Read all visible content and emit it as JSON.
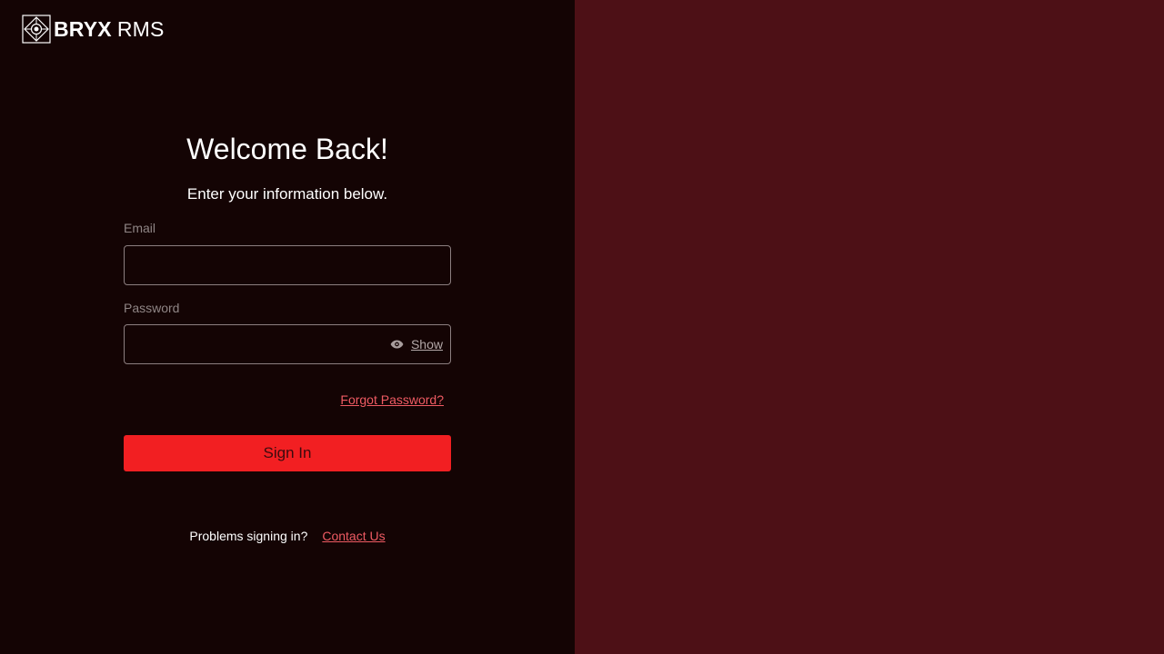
{
  "brand": {
    "name_bold": "BRYX",
    "name_light": "RMS",
    "logo_icon": "bryx-logo-icon"
  },
  "login": {
    "title": "Welcome Back!",
    "subtitle": "Enter your information below.",
    "email": {
      "label": "Email",
      "value": "",
      "placeholder": ""
    },
    "password": {
      "label": "Password",
      "value": "",
      "placeholder": "",
      "toggle_label": "Show",
      "toggle_icon": "eye-icon"
    },
    "forgot_label": "Forgot Password?",
    "signin_label": "Sign In",
    "help_text": "Problems signing in?",
    "contact_label": "Contact Us"
  },
  "colors": {
    "left_panel_bg": "#140404",
    "right_panel_bg": "#4d1016",
    "primary_button": "#f21f22",
    "link": "#ef5b63",
    "text": "#ffffff",
    "muted_label": "#8f8585"
  }
}
